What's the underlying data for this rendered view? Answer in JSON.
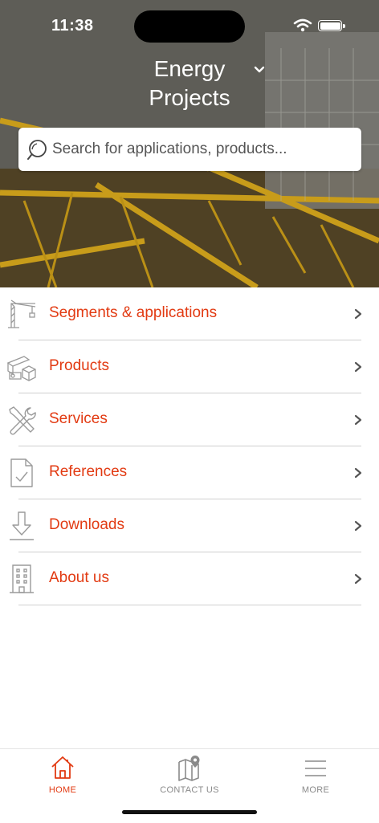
{
  "status_bar": {
    "time": "11:38"
  },
  "header": {
    "title_line1": "Energy",
    "title_line2": "Projects",
    "dropdown_icon": "chevron-down-icon"
  },
  "search": {
    "placeholder": "Search for applications, products..."
  },
  "menu": {
    "items": [
      {
        "label": "Segments & applications",
        "icon": "crane-icon"
      },
      {
        "label": "Products",
        "icon": "products-icon"
      },
      {
        "label": "Services",
        "icon": "tools-icon"
      },
      {
        "label": "References",
        "icon": "document-check-icon"
      },
      {
        "label": "Downloads",
        "icon": "download-icon"
      },
      {
        "label": "About us",
        "icon": "building-icon"
      }
    ]
  },
  "tab_bar": {
    "items": [
      {
        "label": "HOME",
        "icon": "home-icon",
        "active": true
      },
      {
        "label": "CONTACT US",
        "icon": "map-pin-icon",
        "active": false
      },
      {
        "label": "MORE",
        "icon": "hamburger-menu-icon",
        "active": false
      }
    ]
  },
  "colors": {
    "accent": "#e23a12",
    "tab_inactive": "#8a8a8a",
    "icon_gray": "#9a9a9a"
  }
}
